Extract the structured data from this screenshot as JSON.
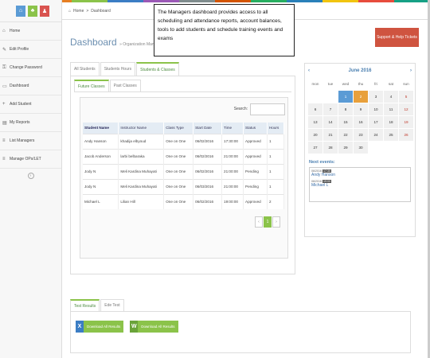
{
  "colors": {
    "accent": "#8bc34a",
    "support": "#cf5440",
    "title": "#6c8fb0"
  },
  "top_bar_colors": [
    "#c0392b",
    "#e67e22",
    "#8bc34a",
    "#3b7dc4",
    "#9b59b6",
    "#7f8c8d",
    "#d35400",
    "#27ae60",
    "#2980b9",
    "#f1c40f",
    "#e74c3c",
    "#16a085"
  ],
  "sidebar": {
    "quick_icons": [
      {
        "icon": "home-icon",
        "color": "#5b9bd5",
        "glyph": "⌂"
      },
      {
        "icon": "shirt-icon",
        "color": "#8bc34a",
        "glyph": "♣"
      },
      {
        "icon": "user-icon",
        "color": "#d9534f",
        "glyph": "♟"
      }
    ],
    "items": [
      {
        "label": "Home",
        "icon": "home-icon",
        "glyph": "⌂"
      },
      {
        "label": "Edit Profile",
        "icon": "pencil-icon",
        "glyph": "✎"
      },
      {
        "label": "Change Password",
        "icon": "lock-icon",
        "glyph": "⚿"
      },
      {
        "label": "Dashboard",
        "icon": "monitor-icon",
        "glyph": "▭"
      },
      {
        "label": "Add Student",
        "icon": "plus-icon",
        "glyph": "+"
      },
      {
        "label": "My Reports",
        "icon": "report-icon",
        "glyph": "▤"
      },
      {
        "label": "List Managers",
        "icon": "list-icon",
        "glyph": "≡"
      },
      {
        "label": "Manage OPs/LET",
        "icon": "list-icon",
        "glyph": "≡"
      }
    ]
  },
  "breadcrumb": {
    "home": "Home",
    "sep": ">",
    "current": "Dashboard"
  },
  "header": {
    "title": "Dashboard",
    "subtitle": "» Organization Manager"
  },
  "tooltip": "The Managers dashboard provides access to all scheduling and attendance reports, account balances, tools to add students and schedule training events and exams",
  "support_button": "Support & Help Tickets",
  "main_tabs": [
    "All Students",
    "Students Hours",
    "Students & Classes"
  ],
  "sub_tabs": [
    "Future Classes",
    "Past Classes"
  ],
  "search_label": "Search:",
  "table": {
    "headers": [
      "Student Name",
      "Instructor Name",
      "Class Type",
      "Start Date",
      "Time",
      "Status",
      "Hours"
    ],
    "rows": [
      [
        "Andy Hanson",
        "khadija elbyoud",
        "One on One",
        "06/02/2016",
        "17:30:00",
        "Approved",
        "1"
      ],
      [
        "Jacob Anderson",
        "larbi belbaraka",
        "One on One",
        "06/02/2016",
        "21:00:00",
        "Approved",
        "1"
      ],
      [
        "Jody N",
        "Meli Kardina Muhayati",
        "One on One",
        "06/02/2016",
        "21:00:00",
        "Pending",
        "1"
      ],
      [
        "Jody N",
        "Meli Kardina Muhayati",
        "One on One",
        "06/03/2016",
        "21:00:00",
        "Pending",
        "1"
      ],
      [
        "Michael L",
        "Lilian Hill",
        "One on One",
        "06/02/2016",
        "19:00:00",
        "Approved",
        "2"
      ]
    ]
  },
  "pager": {
    "prev": "‹",
    "page": "1",
    "next": "›"
  },
  "calendar": {
    "prev": "‹",
    "title": "June 2016",
    "next": "›",
    "dow": [
      "mon",
      "tue",
      "wed",
      "thu",
      "fri",
      "sat",
      "sun"
    ],
    "weeks": [
      [
        "",
        "",
        "1",
        "2",
        "3",
        "4",
        "5"
      ],
      [
        "6",
        "7",
        "8",
        "9",
        "10",
        "11",
        "12"
      ],
      [
        "13",
        "14",
        "15",
        "16",
        "17",
        "18",
        "19"
      ],
      [
        "20",
        "21",
        "22",
        "23",
        "24",
        "25",
        "26"
      ],
      [
        "27",
        "28",
        "29",
        "30",
        "",
        "",
        ""
      ]
    ],
    "today": "1",
    "highlight": "2",
    "red_dates": [
      "5",
      "12",
      "19",
      "26"
    ],
    "today_color": "#5b9bd5",
    "highlight_color": "#e8a03b",
    "weekend_color": "#c0392b"
  },
  "next_events": {
    "title": "Next events:",
    "items": [
      {
        "date": "06/2016",
        "time": "17:30",
        "name": "Andy Hanson"
      },
      {
        "date": "06/2016",
        "time": "19:00",
        "name": "Michael L"
      }
    ]
  },
  "bottom_tabs": [
    "Test Results",
    "Ede Test"
  ],
  "downloads": [
    {
      "label": "Download All Results",
      "icon": "excel-icon",
      "letter": "X",
      "icon_color": "#3b7dc4"
    },
    {
      "label": "Download All Results",
      "icon": "word-icon",
      "letter": "W",
      "icon_color": "#6aa33a"
    }
  ]
}
